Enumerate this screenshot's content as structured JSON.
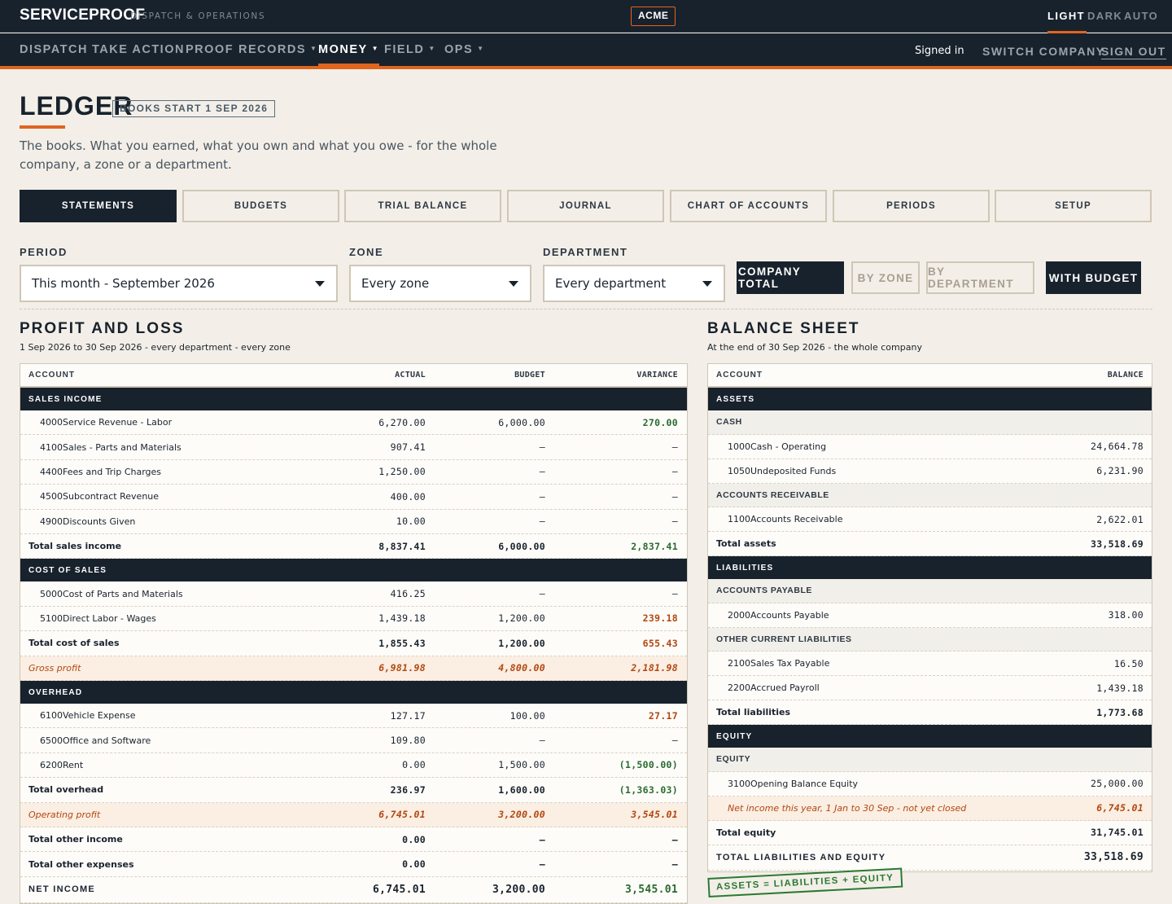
{
  "app": {
    "brand": "SERVICEPROOF",
    "brand_sub": "DISPATCH & OPERATIONS",
    "tenant": "ACME",
    "themes": [
      "LIGHT",
      "DARK",
      "AUTO"
    ]
  },
  "nav": {
    "items": [
      {
        "label": "DISPATCH",
        "caret": false
      },
      {
        "label": "TAKE ACTION",
        "caret": false
      },
      {
        "label": "PROOF",
        "caret": false
      },
      {
        "label": "RECORDS",
        "caret": true
      },
      {
        "label": "MONEY",
        "caret": true
      },
      {
        "label": "FIELD",
        "caret": true
      },
      {
        "label": "OPS",
        "caret": true
      }
    ],
    "signed_in": "Signed in",
    "switch_company": "SWITCH COMPANY",
    "sign_out": "SIGN OUT"
  },
  "page": {
    "title": "LEDGER",
    "badge": "BOOKS START 1 SEP 2026",
    "intro": "The books. What you earned, what you own and what you owe - for the whole company, a zone or a department."
  },
  "tabs": [
    "STATEMENTS",
    "BUDGETS",
    "TRIAL BALANCE",
    "JOURNAL",
    "CHART OF ACCOUNTS",
    "PERIODS",
    "SETUP"
  ],
  "filters": {
    "period": {
      "label": "PERIOD",
      "value": "This month - September 2026"
    },
    "zone": {
      "label": "ZONE",
      "value": "Every zone"
    },
    "department": {
      "label": "DEPARTMENT",
      "value": "Every department"
    },
    "views": [
      "COMPANY TOTAL",
      "BY ZONE",
      "BY DEPARTMENT",
      "WITH BUDGET"
    ]
  },
  "pnl": {
    "title": "PROFIT AND LOSS",
    "subtitle": "1 Sep 2026 to 30 Sep 2026 - every department - every zone",
    "columns": [
      "ACCOUNT",
      "ACTUAL",
      "BUDGET",
      "VARIANCE"
    ],
    "rows": [
      {
        "type": "band",
        "label": "SALES INCOME"
      },
      {
        "type": "acct",
        "code": "4000",
        "label": "Service Revenue - Labor",
        "actual": "6,270.00",
        "budget": "6,000.00",
        "variance": "270.00",
        "vclass": "pos"
      },
      {
        "type": "acct",
        "code": "4100",
        "label": "Sales - Parts and Materials",
        "actual": "907.41",
        "budget": "–",
        "variance": "–"
      },
      {
        "type": "acct",
        "code": "4400",
        "label": "Fees and Trip Charges",
        "actual": "1,250.00",
        "budget": "–",
        "variance": "–"
      },
      {
        "type": "acct",
        "code": "4500",
        "label": "Subcontract Revenue",
        "actual": "400.00",
        "budget": "–",
        "variance": "–"
      },
      {
        "type": "acct",
        "code": "4900",
        "label": "Discounts Given",
        "actual": "10.00",
        "budget": "–",
        "variance": "–"
      },
      {
        "type": "total",
        "label": "Total sales income",
        "actual": "8,837.41",
        "budget": "6,000.00",
        "variance": "2,837.41",
        "vclass": "pos"
      },
      {
        "type": "band",
        "label": "COST OF SALES"
      },
      {
        "type": "acct",
        "code": "5000",
        "label": "Cost of Parts and Materials",
        "actual": "416.25",
        "budget": "–",
        "variance": "–"
      },
      {
        "type": "acct",
        "code": "5100",
        "label": "Direct Labor - Wages",
        "actual": "1,439.18",
        "budget": "1,200.00",
        "variance": "239.18",
        "vclass": "neg"
      },
      {
        "type": "total",
        "label": "Total cost of sales",
        "actual": "1,855.43",
        "budget": "1,200.00",
        "variance": "655.43",
        "vclass": "neg"
      },
      {
        "type": "hl",
        "label": "Gross profit",
        "actual": "6,981.98",
        "budget": "4,800.00",
        "variance": "2,181.98",
        "vclass": "pos"
      },
      {
        "type": "band",
        "label": "OVERHEAD"
      },
      {
        "type": "acct",
        "code": "6100",
        "label": "Vehicle Expense",
        "actual": "127.17",
        "budget": "100.00",
        "variance": "27.17",
        "vclass": "neg"
      },
      {
        "type": "acct",
        "code": "6500",
        "label": "Office and Software",
        "actual": "109.80",
        "budget": "–",
        "variance": "–"
      },
      {
        "type": "acct",
        "code": "6200",
        "label": "Rent",
        "actual": "0.00",
        "budget": "1,500.00",
        "variance": "(1,500.00)",
        "vclass": "pos"
      },
      {
        "type": "total",
        "label": "Total overhead",
        "actual": "236.97",
        "budget": "1,600.00",
        "variance": "(1,363.03)",
        "vclass": "pos"
      },
      {
        "type": "hl",
        "label": "Operating profit",
        "actual": "6,745.01",
        "budget": "3,200.00",
        "variance": "3,545.01",
        "vclass": "pos"
      },
      {
        "type": "total",
        "label": "Total other income",
        "actual": "0.00",
        "budget": "–",
        "variance": "–"
      },
      {
        "type": "total",
        "label": "Total other expenses",
        "actual": "0.00",
        "budget": "–",
        "variance": "–"
      },
      {
        "type": "net",
        "label": "NET INCOME",
        "actual": "6,745.01",
        "budget": "3,200.00",
        "variance": "3,545.01",
        "vclass": "pos"
      }
    ]
  },
  "bs": {
    "title": "BALANCE SHEET",
    "subtitle": "At the end of 30 Sep 2026 - the whole company",
    "columns": [
      "ACCOUNT",
      "BALANCE"
    ],
    "rows": [
      {
        "type": "band",
        "label": "ASSETS"
      },
      {
        "type": "sub",
        "label": "CASH"
      },
      {
        "type": "acct",
        "code": "1000",
        "label": "Cash - Operating",
        "balance": "24,664.78"
      },
      {
        "type": "acct",
        "code": "1050",
        "label": "Undeposited Funds",
        "balance": "6,231.90"
      },
      {
        "type": "sub",
        "label": "ACCOUNTS RECEIVABLE"
      },
      {
        "type": "acct",
        "code": "1100",
        "label": "Accounts Receivable",
        "balance": "2,622.01"
      },
      {
        "type": "total",
        "label": "Total assets",
        "balance": "33,518.69"
      },
      {
        "type": "band",
        "label": "LIABILITIES"
      },
      {
        "type": "sub",
        "label": "ACCOUNTS PAYABLE"
      },
      {
        "type": "acct",
        "code": "2000",
        "label": "Accounts Payable",
        "balance": "318.00"
      },
      {
        "type": "sub",
        "label": "OTHER CURRENT LIABILITIES"
      },
      {
        "type": "acct",
        "code": "2100",
        "label": "Sales Tax Payable",
        "balance": "16.50"
      },
      {
        "type": "acct",
        "code": "2200",
        "label": "Accrued Payroll",
        "balance": "1,439.18"
      },
      {
        "type": "total",
        "label": "Total liabilities",
        "balance": "1,773.68"
      },
      {
        "type": "band",
        "label": "EQUITY"
      },
      {
        "type": "sub",
        "label": "EQUITY"
      },
      {
        "type": "acct",
        "code": "3100",
        "label": "Opening Balance Equity",
        "balance": "25,000.00"
      },
      {
        "type": "hl",
        "label": "Net income this year, 1 Jan to 30 Sep - not yet closed",
        "balance": "6,745.01"
      },
      {
        "type": "total",
        "label": "Total equity",
        "balance": "31,745.01"
      },
      {
        "type": "net",
        "label": "TOTAL LIABILITIES AND EQUITY",
        "balance": "33,518.69"
      }
    ],
    "stamp": "ASSETS = LIABILITIES + EQUITY"
  },
  "colors": {
    "accent": "#e0651e",
    "navy": "#18222d",
    "positive": "#2a6b2f",
    "negative": "#b2470e"
  }
}
